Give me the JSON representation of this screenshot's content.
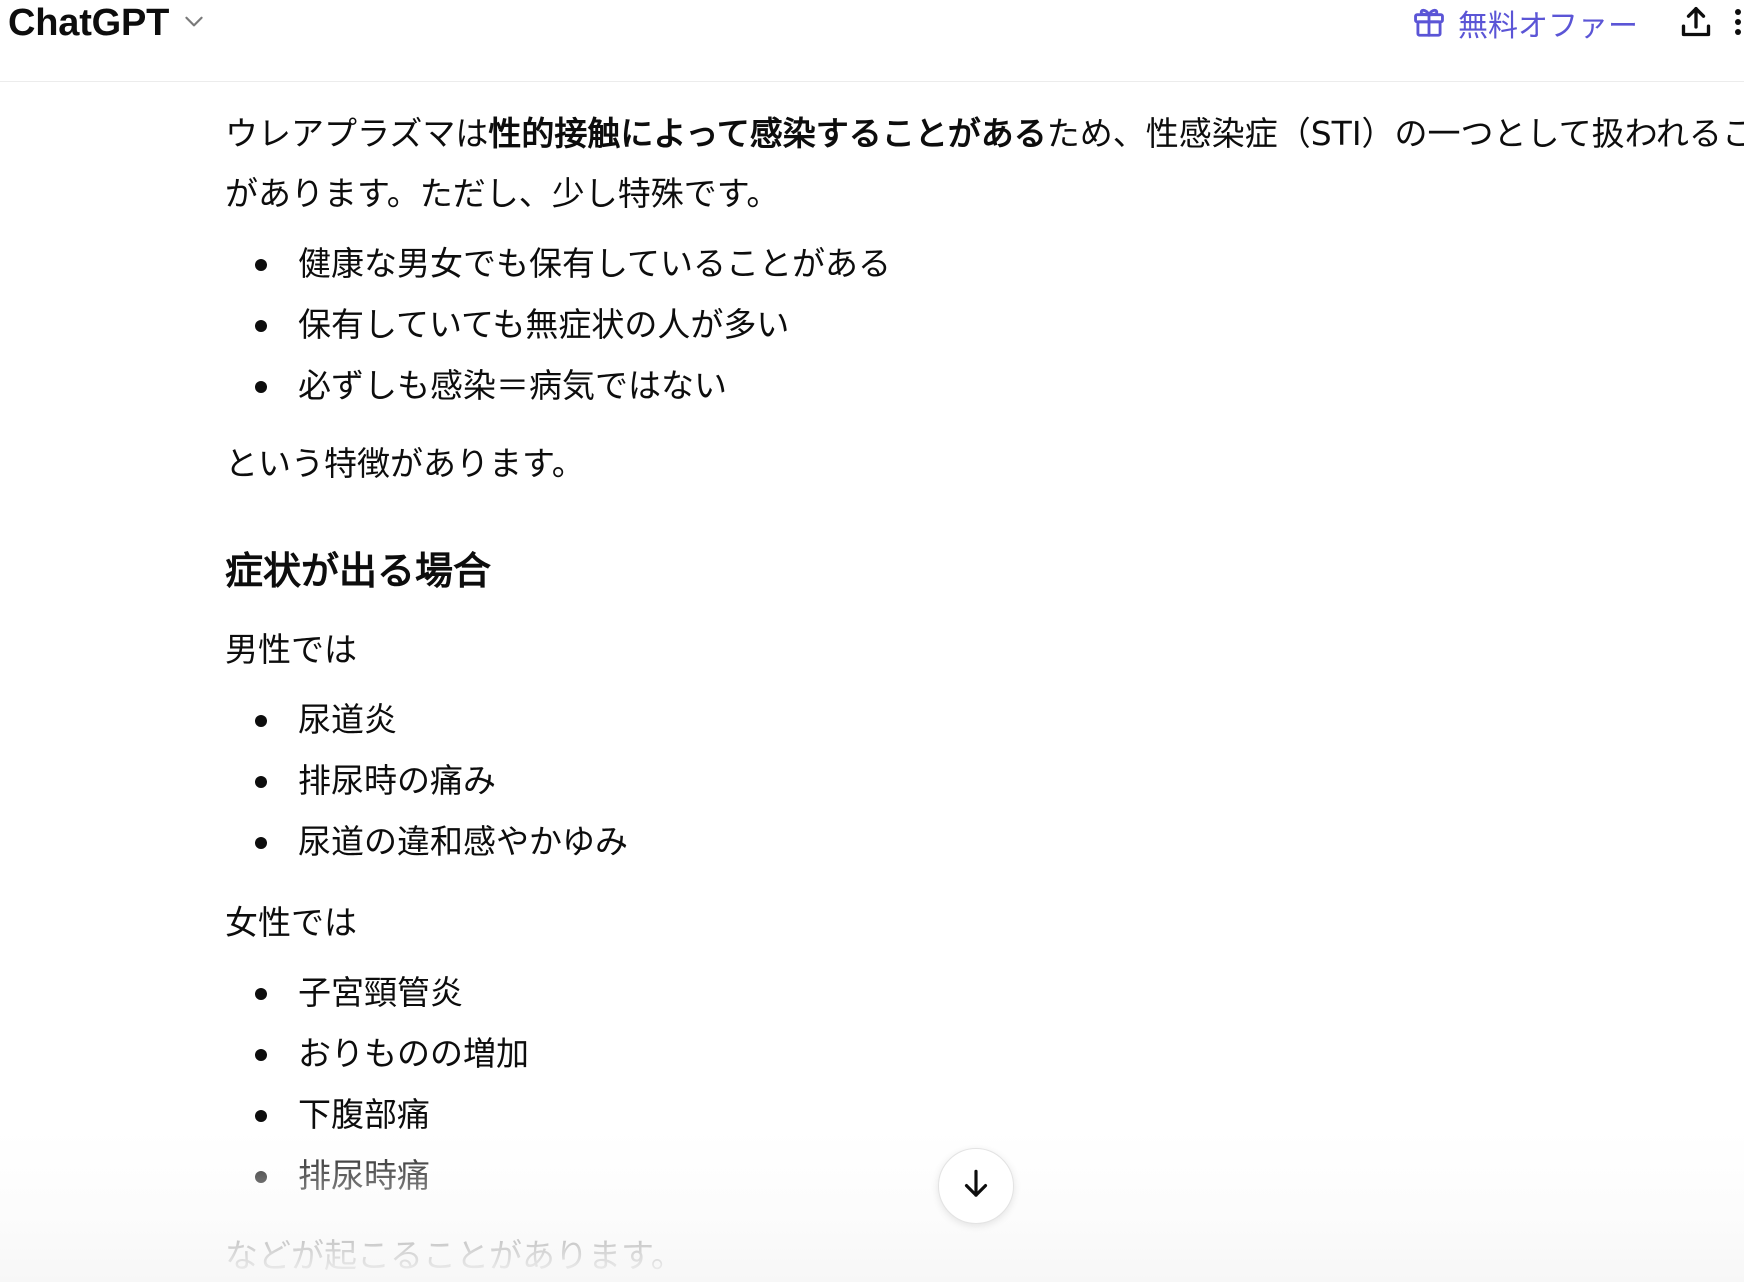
{
  "header": {
    "model_name": "ChatGPT",
    "offer_label": "無料オファー"
  },
  "message": {
    "intro_prefix": "ウレアプラズマは",
    "intro_bold": "性的接触によって感染することがある",
    "intro_suffix": "ため、性感染症（STI）の一つとして扱われること",
    "intro_line2": "があります。ただし、少し特殊です。",
    "features": [
      "健康な男女でも保有していることがある",
      "保有していても無症状の人が多い",
      "必ずしも感染＝病気ではない"
    ],
    "features_after": "という特徴があります。",
    "symptoms_heading": "症状が出る場合",
    "male_label": "男性では",
    "male_symptoms": [
      "尿道炎",
      "排尿時の痛み",
      "尿道の違和感やかゆみ"
    ],
    "female_label": "女性では",
    "female_symptoms": [
      "子宮頸管炎",
      "おりものの増加",
      "下腹部痛",
      "排尿時痛"
    ],
    "closing": "などが起こることがあります。"
  },
  "icons": {
    "model_chevron": "chevron-down-icon",
    "offer": "gift-icon",
    "share": "share-icon",
    "scroll": "arrow-down-icon"
  },
  "colors": {
    "accent": "#5b55d6",
    "text": "#0d0d0d"
  }
}
